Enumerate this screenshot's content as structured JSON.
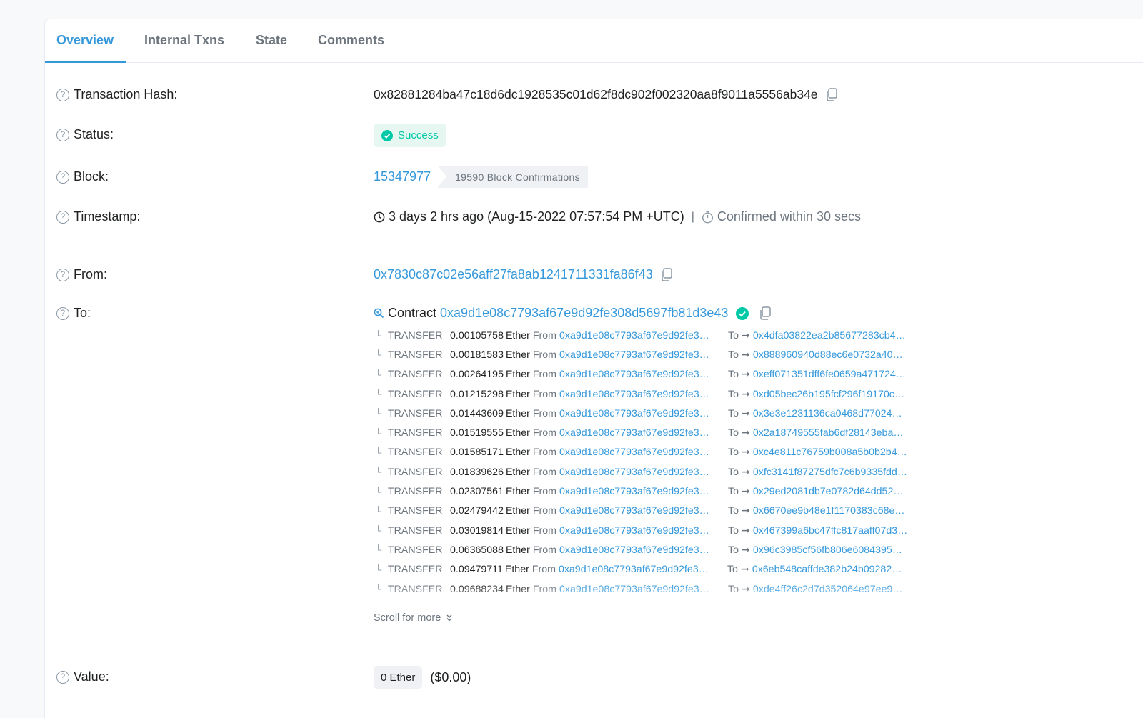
{
  "tabs": [
    {
      "label": "Overview"
    },
    {
      "label": "Internal Txns"
    },
    {
      "label": "State"
    },
    {
      "label": "Comments"
    }
  ],
  "fields": {
    "tx_hash_label": "Transaction Hash:",
    "tx_hash": "0x82881284ba47c18d6dc1928535c01d62f8dc902f002320aa8f9011a5556ab34e",
    "status_label": "Status:",
    "status": "Success",
    "block_label": "Block:",
    "block": "15347977",
    "block_confirmations": "19590 Block Confirmations",
    "timestamp_label": "Timestamp:",
    "timestamp": "3 days 2 hrs ago (Aug-15-2022 07:57:54 PM +UTC)",
    "timestamp_sep": "|",
    "confirmed_within": "Confirmed within 30 secs",
    "from_label": "From:",
    "from": "0x7830c87c02e56aff27fa8ab1241711331fa86f43",
    "to_label": "To:",
    "to_prefix": "Contract",
    "to_contract": "0xa9d1e08c7793af67e9d92fe308d5697fb81d3e43",
    "value_label": "Value:",
    "value_ether": "0 Ether",
    "value_usd": "($0.00)",
    "scroll_more": "Scroll for more"
  },
  "transfer_words": {
    "type": "TRANSFER",
    "unit": "Ether",
    "from": "From",
    "to": "To"
  },
  "transfers": [
    {
      "amount": "0.00105758",
      "from": "0xa9d1e08c7793af67e9d92fe3…",
      "to": "0x4dfa03822ea2b85677283cb4…"
    },
    {
      "amount": "0.00181583",
      "from": "0xa9d1e08c7793af67e9d92fe3…",
      "to": "0x888960940d88ec6e0732a40…"
    },
    {
      "amount": "0.00264195",
      "from": "0xa9d1e08c7793af67e9d92fe3…",
      "to": "0xeff071351dff6fe0659a471724…"
    },
    {
      "amount": "0.01215298",
      "from": "0xa9d1e08c7793af67e9d92fe3…",
      "to": "0xd05bec26b195fcf296f19170c…"
    },
    {
      "amount": "0.01443609",
      "from": "0xa9d1e08c7793af67e9d92fe3…",
      "to": "0x3e3e1231136ca0468d77024…"
    },
    {
      "amount": "0.01519555",
      "from": "0xa9d1e08c7793af67e9d92fe3…",
      "to": "0x2a18749555fab6df28143eba…"
    },
    {
      "amount": "0.01585171",
      "from": "0xa9d1e08c7793af67e9d92fe3…",
      "to": "0xc4e811c76759b008a5b0b2b4…"
    },
    {
      "amount": "0.01839626",
      "from": "0xa9d1e08c7793af67e9d92fe3…",
      "to": "0xfc3141f87275dfc7c6b9335fdd…"
    },
    {
      "amount": "0.02307561",
      "from": "0xa9d1e08c7793af67e9d92fe3…",
      "to": "0x29ed2081db7e0782d64dd52…"
    },
    {
      "amount": "0.02479442",
      "from": "0xa9d1e08c7793af67e9d92fe3…",
      "to": "0x6670ee9b48e1f1170383c68e…"
    },
    {
      "amount": "0.03019814",
      "from": "0xa9d1e08c7793af67e9d92fe3…",
      "to": "0x467399a6bc47ffc817aaff07d3…"
    },
    {
      "amount": "0.06365088",
      "from": "0xa9d1e08c7793af67e9d92fe3…",
      "to": "0x96c3985cf56fb806e6084395…"
    },
    {
      "amount": "0.09479711",
      "from": "0xa9d1e08c7793af67e9d92fe3…",
      "to": "0x6eb548caffde382b24b09282…"
    },
    {
      "amount": "0.09688234",
      "from": "0xa9d1e08c7793af67e9d92fe3…",
      "to": "0xde4ff26c2d7d352064e97ee9…"
    }
  ],
  "colors": {
    "accent": "#3498db",
    "success": "#00c9a7",
    "muted": "#6c757e"
  }
}
